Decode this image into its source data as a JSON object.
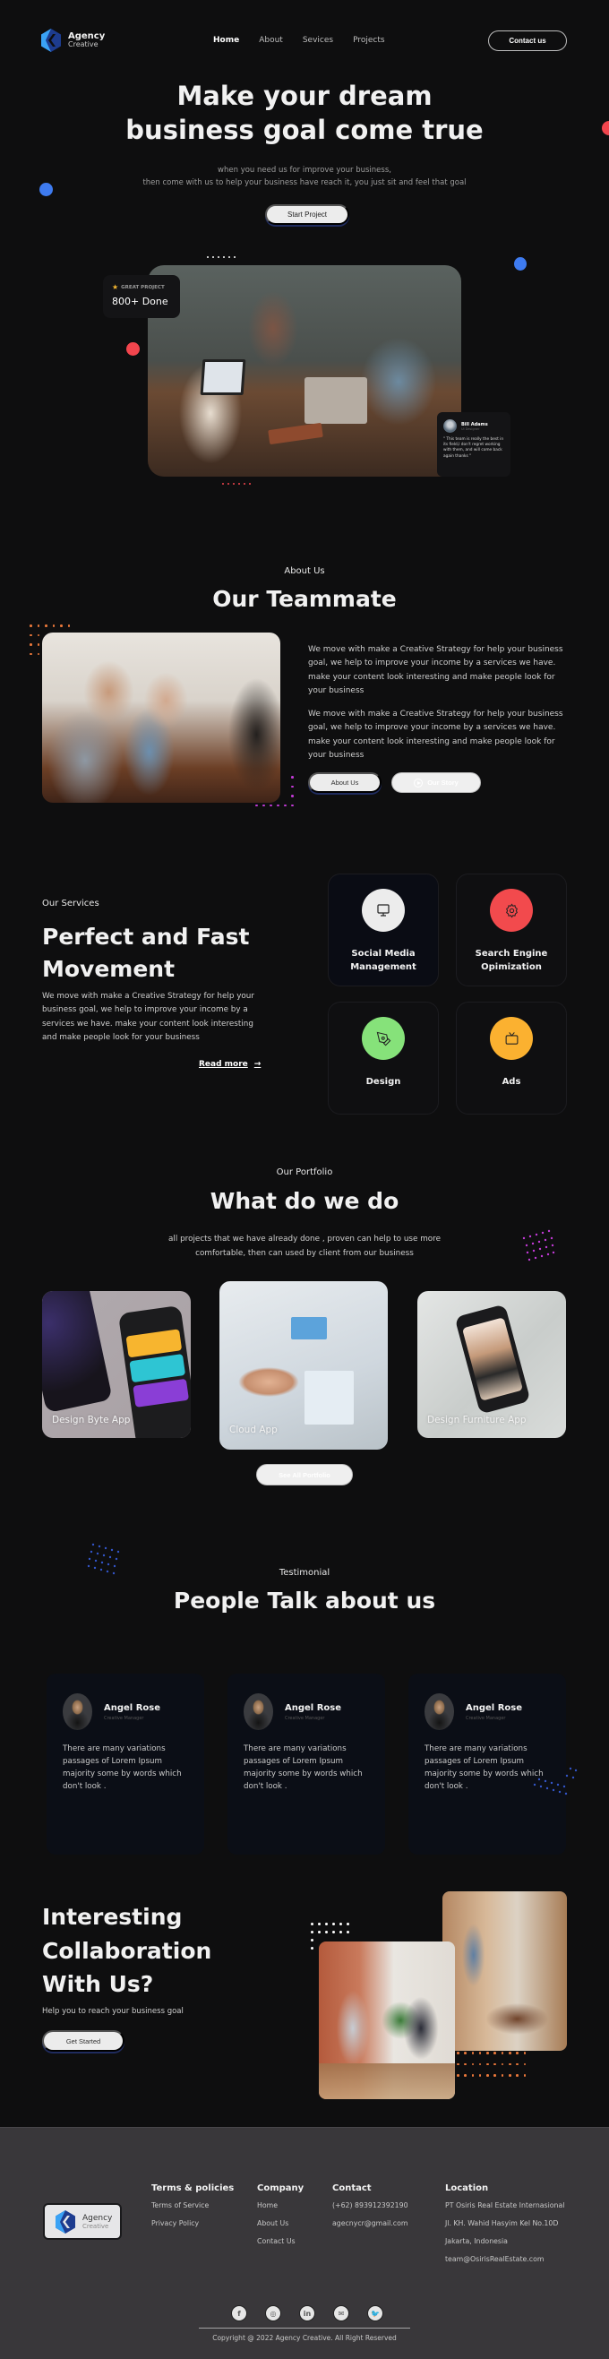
{
  "brand": {
    "name": "Agency",
    "tagline": "Creative"
  },
  "nav": {
    "items": [
      {
        "label": "Home",
        "active": true
      },
      {
        "label": "About",
        "active": false
      },
      {
        "label": "Sevices",
        "active": false
      },
      {
        "label": "Projects",
        "active": false
      }
    ],
    "contact_label": "Contact us"
  },
  "hero": {
    "title_line1": "Make your dream",
    "title_line2": "business goal come true",
    "subtitle_line1": "when you need us for improve your business,",
    "subtitle_line2": "then come with us to help your business have reach it, you just sit and feel that goal",
    "cta_label": "Start Project",
    "stat": {
      "label": "GREAT PROJECT",
      "value": "800+ Done"
    },
    "review": {
      "name": "Bill Adams",
      "role": "UI Designer",
      "text": "\" This team is really the best in its field,I don't regret working with them, and will come back again thanks \""
    }
  },
  "about": {
    "eyebrow": "About Us",
    "title": "Our Teammate",
    "paragraphs": [
      "We move with make a Creative Strategy for help your business goal, we help to improve your income by a services we have. make your content look interesting and make people look for your business",
      "We move with make a Creative Strategy for help your business goal, we help to improve your income by a services we have. make your content look interesting and make people look for your business"
    ],
    "about_button": "About Us",
    "story_button": "Our Story"
  },
  "services": {
    "eyebrow": "Our Services",
    "title": "Perfect and Fast Movement",
    "text": "We move with make a Creative Strategy for help your business goal, we help to improve your income by a services we have. make your content look interesting and make people look for your business",
    "read_more": "Read more",
    "items": [
      {
        "label": "Social Media Management",
        "icon": "monitor-icon",
        "color": "#ececec"
      },
      {
        "label": "Search Engine Opimization",
        "icon": "gear-icon",
        "color": "#f24a4d"
      },
      {
        "label": "Design",
        "icon": "pen-tool-icon",
        "color": "#86e27a"
      },
      {
        "label": "Ads",
        "icon": "tv-icon",
        "color": "#fbb130"
      }
    ]
  },
  "portfolio": {
    "eyebrow": "Our Portfolio",
    "title": "What do we do",
    "subtitle_line1": "all projects that we have already done , proven can help to use more",
    "subtitle_line2": "comfortable, then can used by client from our business",
    "items": [
      {
        "label": "Design Byte App"
      },
      {
        "label": "Cloud App"
      },
      {
        "label": "Design Furniture App"
      }
    ],
    "see_all": "See All Portfolio"
  },
  "testimonial": {
    "eyebrow": "Testimonial",
    "title": "People Talk about us",
    "items": [
      {
        "name": "Angel Rose",
        "role": "Creative Manager",
        "text": "There are many variations passages of Lorem Ipsum majority some by words which don't look ."
      },
      {
        "name": "Angel Rose",
        "role": "Creative Manager",
        "text": "There are many variations passages of Lorem Ipsum majority some by words which don't look ."
      },
      {
        "name": "Angel Rose",
        "role": "Creative Manager",
        "text": "There are many variations passages of Lorem Ipsum majority some by words which don't look ."
      }
    ]
  },
  "cta": {
    "title_line1": "Interesting",
    "title_line2": "Collaboration",
    "title_line3": "With Us?",
    "subtitle": "Help you to reach your business goal",
    "button": "Get Started"
  },
  "footer": {
    "columns": [
      {
        "heading": "Terms & policies",
        "links": [
          "Terms of Service",
          "Privacy Policy"
        ]
      },
      {
        "heading": "Company",
        "links": [
          "Home",
          "About Us",
          "Contact Us"
        ]
      },
      {
        "heading": "Contact",
        "links": [
          "(+62) 893912392190",
          "agecnycr@gmail.com"
        ]
      },
      {
        "heading": "Location",
        "links": [
          "PT Osiris Real Estate Internasional",
          "Jl. KH. Wahid Hasyim Kel No.10D",
          "Jakarta, Indonesia",
          "team@OsirisRealEstate.com"
        ]
      }
    ],
    "socials": [
      {
        "name": "facebook-icon",
        "glyph": "f"
      },
      {
        "name": "instagram-icon",
        "glyph": "◎"
      },
      {
        "name": "linkedin-icon",
        "glyph": "in"
      },
      {
        "name": "mail-icon",
        "glyph": "✉"
      },
      {
        "name": "twitter-icon",
        "glyph": "🐦"
      }
    ],
    "copyright": "Copyright @ 2022 Agency Creative. All Right Reserved"
  },
  "colors": {
    "background": "#0e0e0f",
    "footer": "#39373a",
    "accent_blue": "#3e7bf0",
    "accent_red": "#f2454d",
    "accent_orange": "#e9773a",
    "accent_magenta": "#c23ad6"
  }
}
